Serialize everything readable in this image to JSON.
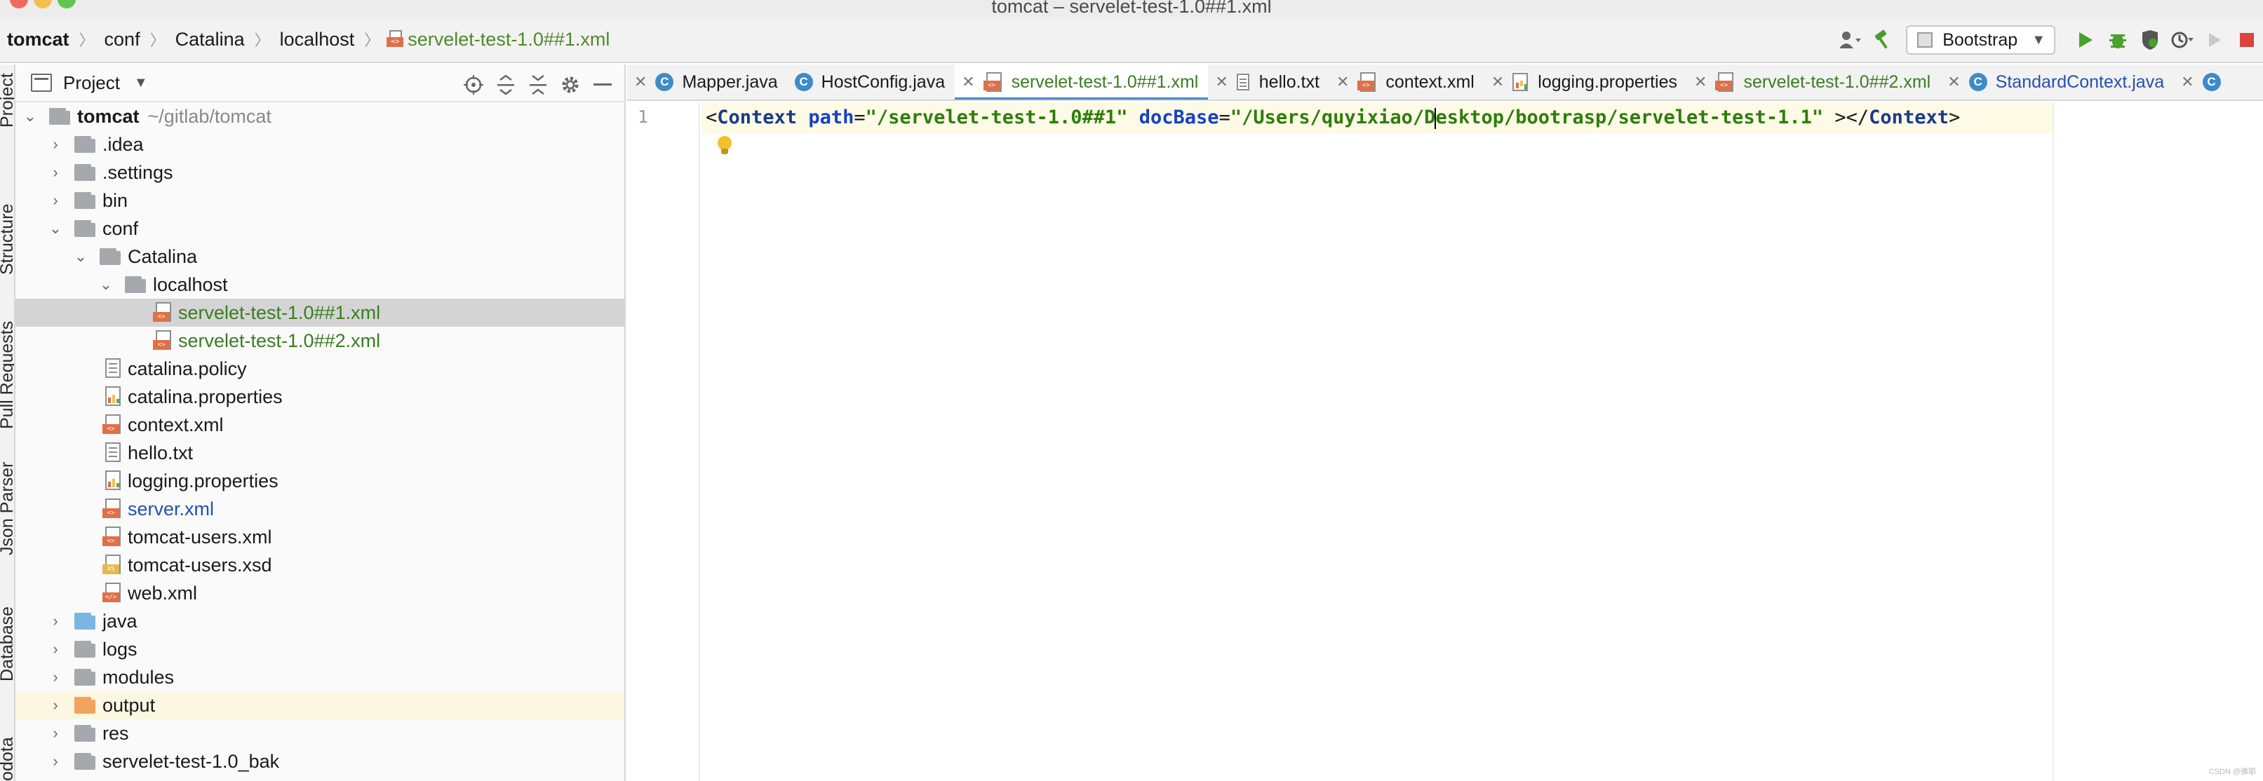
{
  "window": {
    "title": "tomcat – servelet-test-1.0##1.xml"
  },
  "breadcrumb": [
    "tomcat",
    "conf",
    "Catalina",
    "localhost",
    "servelet-test-1.0##1.xml"
  ],
  "toolbar": {
    "run_config": "Bootstrap"
  },
  "side_tabs": [
    "Project",
    "Structure",
    "Pull Requests",
    "Json Parser",
    "Database",
    "Codota"
  ],
  "project_panel": {
    "title": "Project",
    "root_label": "tomcat",
    "root_path": "~/gitlab/tomcat",
    "items": [
      {
        "label": ".idea"
      },
      {
        "label": ".settings"
      },
      {
        "label": "bin"
      },
      {
        "label": "conf"
      },
      {
        "label": "Catalina"
      },
      {
        "label": "localhost"
      },
      {
        "label": "servelet-test-1.0##1.xml"
      },
      {
        "label": "servelet-test-1.0##2.xml"
      },
      {
        "label": "catalina.policy"
      },
      {
        "label": "catalina.properties"
      },
      {
        "label": "context.xml"
      },
      {
        "label": "hello.txt"
      },
      {
        "label": "logging.properties"
      },
      {
        "label": "server.xml"
      },
      {
        "label": "tomcat-users.xml"
      },
      {
        "label": "tomcat-users.xsd"
      },
      {
        "label": "web.xml"
      },
      {
        "label": "java"
      },
      {
        "label": "logs"
      },
      {
        "label": "modules"
      },
      {
        "label": "output"
      },
      {
        "label": "res"
      },
      {
        "label": "servelet-test-1.0_bak"
      }
    ]
  },
  "tabs": [
    {
      "label": "Mapper.java",
      "icon": "java-class-icon"
    },
    {
      "label": "HostConfig.java",
      "icon": "java-class-icon"
    },
    {
      "label": "servelet-test-1.0##1.xml",
      "icon": "xml-file-icon",
      "active": true
    },
    {
      "label": "hello.txt",
      "icon": "text-file-icon"
    },
    {
      "label": "context.xml",
      "icon": "xml-file-icon"
    },
    {
      "label": "logging.properties",
      "icon": "properties-file-icon"
    },
    {
      "label": "servelet-test-1.0##2.xml",
      "icon": "xml-file-icon"
    },
    {
      "label": "StandardContext.java",
      "icon": "java-class-icon"
    }
  ],
  "editor": {
    "line_number": "1",
    "code": {
      "open_bracket": "<",
      "tag": "Context",
      "attr1": "path",
      "eq1": "=",
      "val1": "\"/servelet-test-1.0##1\"",
      "attr2": "docBase",
      "eq2": "=",
      "val2_before_cursor": "\"/Users/quyixiao/D",
      "val2_after_cursor": "esktop/bootrasp/servelet-test-1.1\"",
      "close_open": "></",
      "close_tag": "Context",
      "close_bracket": ">"
    }
  },
  "watermark": "CSDN @佛耶",
  "colors": {
    "accent": "#4a86c8",
    "vcs_new_file": "#3a7d22",
    "vcs_modified_file": "#2450b0",
    "caret_line": "#fdfae6"
  }
}
